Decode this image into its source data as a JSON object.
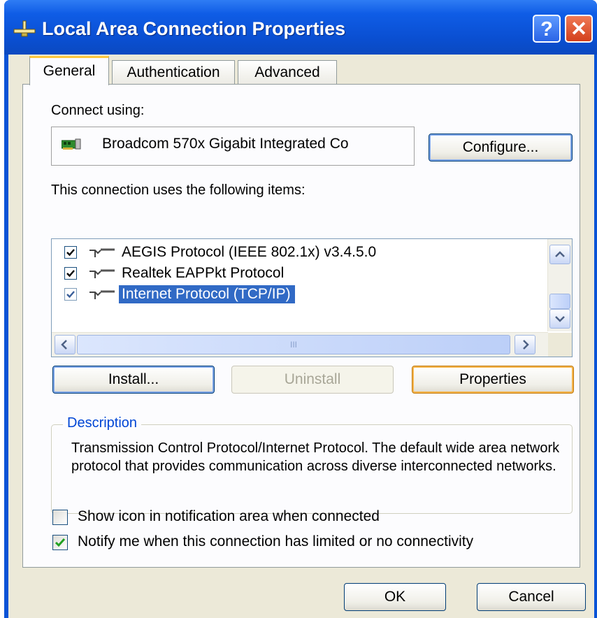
{
  "window": {
    "title": "Local Area Connection Properties",
    "help_label": "?",
    "close_label": "✕"
  },
  "tabs": [
    {
      "label": "General",
      "selected": true
    },
    {
      "label": "Authentication",
      "selected": false
    },
    {
      "label": "Advanced",
      "selected": false
    }
  ],
  "connect": {
    "label": "Connect using:",
    "adapter": "Broadcom 570x Gigabit Integrated Co",
    "configure_label": "Configure..."
  },
  "items": {
    "label": "This connection uses the following items:",
    "list": [
      {
        "label": "AEGIS Protocol (IEEE 802.1x) v3.4.5.0",
        "checked": true,
        "selected": false
      },
      {
        "label": "Realtek EAPPkt Protocol",
        "checked": true,
        "selected": false
      },
      {
        "label": "Internet Protocol (TCP/IP)",
        "checked": true,
        "selected": true
      }
    ],
    "hscroll_grip": "III"
  },
  "buttons": {
    "install": "Install...",
    "uninstall": "Uninstall",
    "properties": "Properties",
    "ok": "OK",
    "cancel": "Cancel"
  },
  "description": {
    "legend": "Description",
    "text": "Transmission Control Protocol/Internet Protocol. The default wide area network protocol that provides communication across diverse interconnected networks."
  },
  "options": [
    {
      "label": "Show icon in notification area when connected",
      "checked": false
    },
    {
      "label": "Notify me when this connection has limited or no connectivity",
      "checked": true
    }
  ],
  "colors": {
    "title_bar": "#0a53d6",
    "selection": "#316ac5",
    "default_button_glow": "#f5b44b",
    "check_green": "#21a121"
  }
}
